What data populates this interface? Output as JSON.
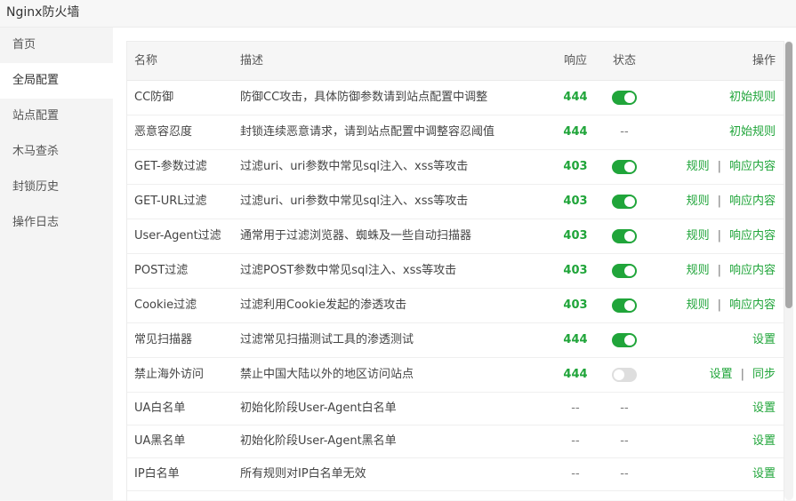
{
  "window": {
    "title": "Nginx防火墙"
  },
  "sidebar": {
    "items": [
      {
        "label": "首页",
        "active": false
      },
      {
        "label": "全局配置",
        "active": true
      },
      {
        "label": "站点配置",
        "active": false
      },
      {
        "label": "木马查杀",
        "active": false
      },
      {
        "label": "封锁历史",
        "active": false
      },
      {
        "label": "操作日志",
        "active": false
      }
    ]
  },
  "table": {
    "headers": {
      "name": "名称",
      "desc": "描述",
      "response": "响应",
      "status": "状态",
      "ops": "操作"
    },
    "rows": [
      {
        "name": "CC防御",
        "desc": "防御CC攻击，具体防御参数请到站点配置中调整",
        "response": "444",
        "status": "on",
        "ops": [
          "初始规则"
        ]
      },
      {
        "name": "恶意容忍度",
        "desc": "封锁连续恶意请求，请到站点配置中调整容忍阈值",
        "response": "444",
        "status": "--",
        "ops": [
          "初始规则"
        ]
      },
      {
        "name": "GET-参数过滤",
        "desc": "过滤uri、uri参数中常见sql注入、xss等攻击",
        "response": "403",
        "status": "on",
        "ops": [
          "规则",
          "响应内容"
        ]
      },
      {
        "name": "GET-URL过滤",
        "desc": "过滤uri、uri参数中常见sql注入、xss等攻击",
        "response": "403",
        "status": "on",
        "ops": [
          "规则",
          "响应内容"
        ]
      },
      {
        "name": "User-Agent过滤",
        "desc": "通常用于过滤浏览器、蜘蛛及一些自动扫描器",
        "response": "403",
        "status": "on",
        "ops": [
          "规则",
          "响应内容"
        ]
      },
      {
        "name": "POST过滤",
        "desc": "过滤POST参数中常见sql注入、xss等攻击",
        "response": "403",
        "status": "on",
        "ops": [
          "规则",
          "响应内容"
        ]
      },
      {
        "name": "Cookie过滤",
        "desc": "过滤利用Cookie发起的渗透攻击",
        "response": "403",
        "status": "on",
        "ops": [
          "规则",
          "响应内容"
        ]
      },
      {
        "name": "常见扫描器",
        "desc": "过滤常见扫描测试工具的渗透测试",
        "response": "444",
        "status": "on",
        "ops": [
          "设置"
        ]
      },
      {
        "name": "禁止海外访问",
        "desc": "禁止中国大陆以外的地区访问站点",
        "response": "444",
        "status": "off",
        "ops": [
          "设置",
          "同步"
        ]
      },
      {
        "name": "UA白名单",
        "desc": "初始化阶段User-Agent白名单",
        "response": "--",
        "status": "--",
        "ops": [
          "设置"
        ]
      },
      {
        "name": "UA黑名单",
        "desc": "初始化阶段User-Agent黑名单",
        "response": "--",
        "status": "--",
        "ops": [
          "设置"
        ]
      },
      {
        "name": "IP白名单",
        "desc": "所有规则对IP白名单无效",
        "response": "--",
        "status": "--",
        "ops": [
          "设置"
        ]
      }
    ]
  },
  "colors": {
    "accent": "#20a53a",
    "toggle_off": "#dedede"
  }
}
